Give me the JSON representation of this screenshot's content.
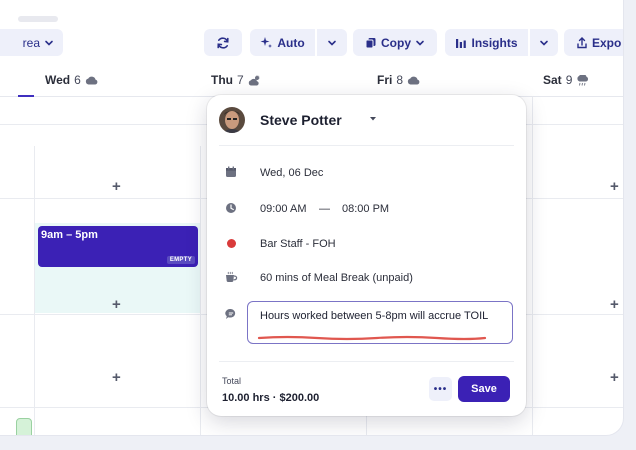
{
  "toolbar": {
    "area_label": "rea",
    "auto_label": "Auto",
    "copy_label": "Copy",
    "insights_label": "Insights",
    "export_label": "Expo"
  },
  "days": [
    {
      "name": "Wed",
      "date": "6",
      "weather": "cloud-icon"
    },
    {
      "name": "Thu",
      "date": "7",
      "weather": "partly-sunny-icon"
    },
    {
      "name": "Fri",
      "date": "8",
      "weather": "cloud-icon"
    },
    {
      "name": "Sat",
      "date": "9",
      "weather": "rain-cloud-icon"
    }
  ],
  "shift": {
    "time": "9am – 5pm",
    "tag": "EMPTY"
  },
  "popover": {
    "employee_name": "Steve Potter",
    "date": "Wed, 06 Dec",
    "start_time": "09:00 AM",
    "time_separator": "—",
    "end_time": "08:00 PM",
    "role": "Bar Staff - FOH",
    "role_color": "#d93b3b",
    "break": "60 mins of Meal Break (unpaid)",
    "note": "Hours worked between 5-8pm will accrue TOIL",
    "total_label": "Total",
    "total_value": "10.00 hrs · $200.00",
    "more_label": "•••",
    "save_label": "Save"
  },
  "colors": {
    "accent": "#3b21b5",
    "accent_light": "#eef0fa"
  }
}
